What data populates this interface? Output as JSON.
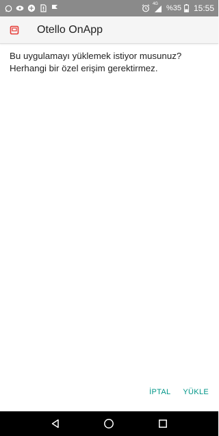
{
  "status_bar": {
    "battery_percent": "%35",
    "time": "15:55",
    "network_label": "4G",
    "left_icons": [
      "whatsapp-icon",
      "eye-icon",
      "vpn-icon",
      "sim-icon",
      "check-flag-icon"
    ],
    "right_icons": [
      "alarm-icon",
      "signal-icon",
      "battery-icon"
    ]
  },
  "header": {
    "title": "Otello OnApp",
    "icon": "app-icon",
    "icon_color": "#e53935"
  },
  "message": {
    "line1": "Bu uygulamayı yüklemek istiyor musunuz?",
    "line2": "Herhangi bir özel erişim gerektirmez."
  },
  "actions": {
    "cancel_label": "İPTAL",
    "install_label": "YÜKLE",
    "accent_color": "#009688"
  },
  "nav_bar": {
    "icons": [
      "back-icon",
      "home-icon",
      "recents-icon"
    ]
  }
}
